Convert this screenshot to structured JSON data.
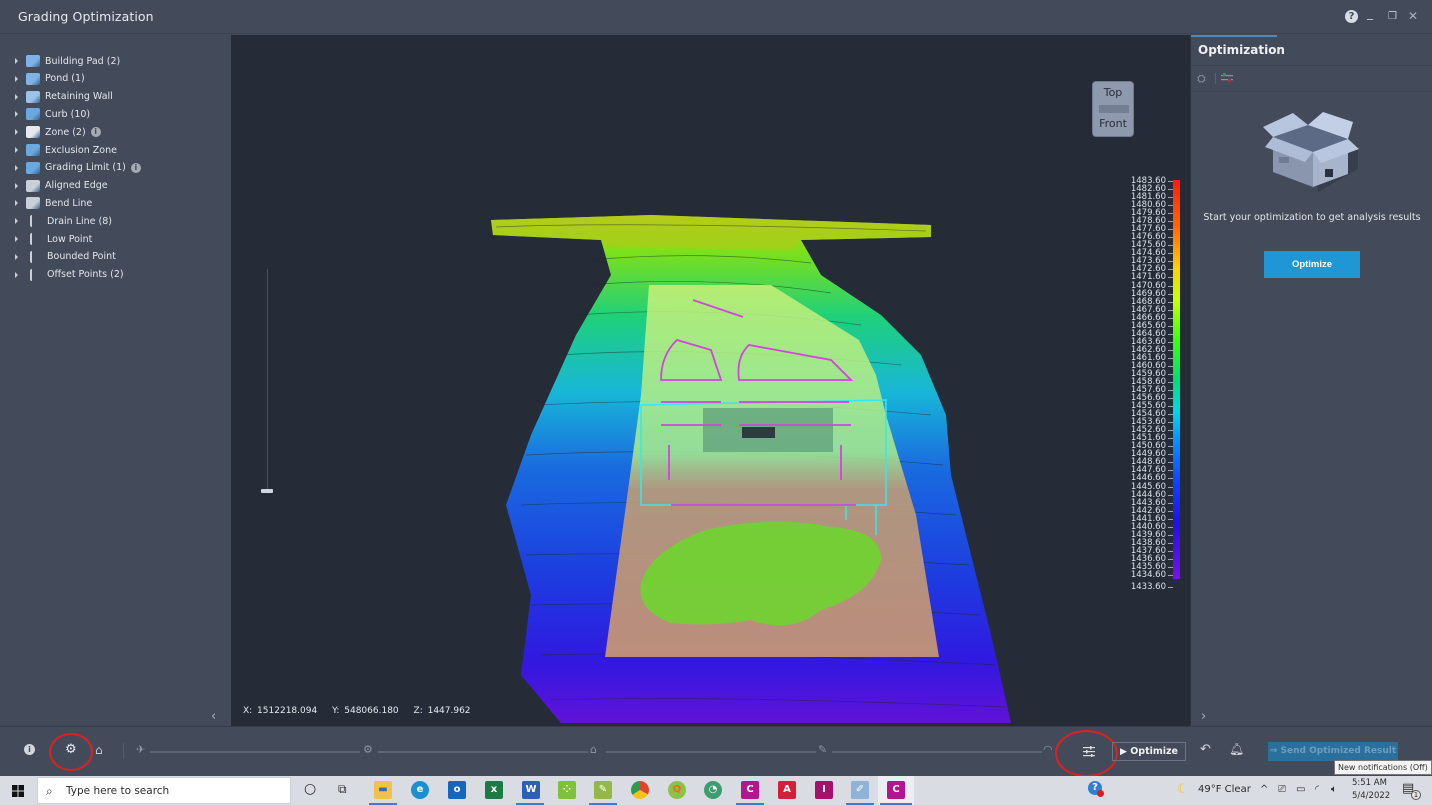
{
  "window": {
    "title": "Grading Optimization",
    "controls": {
      "help": "?",
      "minimize": "_",
      "restore": "❐",
      "close": "✕"
    }
  },
  "sidebar": {
    "items": [
      {
        "label": "Building Pad (2)",
        "icon": "building-pad-icon",
        "info": false
      },
      {
        "label": "Pond (1)",
        "icon": "pond-icon",
        "info": false
      },
      {
        "label": "Retaining Wall",
        "icon": "retaining-wall-icon",
        "info": false
      },
      {
        "label": "Curb (10)",
        "icon": "curb-icon",
        "info": false
      },
      {
        "label": "Zone (2)",
        "icon": "zone-icon",
        "info": true
      },
      {
        "label": "Exclusion Zone",
        "icon": "exclusion-zone-icon",
        "info": false
      },
      {
        "label": "Grading Limit (1)",
        "icon": "grading-limit-icon",
        "info": true
      },
      {
        "label": "Aligned Edge",
        "icon": "aligned-edge-icon",
        "info": false
      },
      {
        "label": "Bend Line",
        "icon": "bend-line-icon",
        "info": false
      },
      {
        "label": "Drain Line (8)",
        "icon": "drain-line-icon",
        "info": false
      },
      {
        "label": "Low Point",
        "icon": "low-point-icon",
        "info": false
      },
      {
        "label": "Bounded Point",
        "icon": "bounded-point-icon",
        "info": false
      },
      {
        "label": "Offset Points (2)",
        "icon": "offset-points-icon",
        "info": false
      }
    ],
    "info_glyph": "i",
    "collapse_glyph": "‹"
  },
  "viewport": {
    "viewcube": {
      "top": "Top",
      "front": "Front"
    },
    "coords": {
      "x": "X: 1512218.094",
      "y": "Y: 548066.180",
      "z": "Z: 1447.962"
    },
    "elevation_legend": {
      "max": 1483.6,
      "min": 1433.6,
      "step": 1.0,
      "labels": [
        "1483.60",
        "1482.60",
        "1481.60",
        "1480.60",
        "1479.60",
        "1478.60",
        "1477.60",
        "1476.60",
        "1475.60",
        "1474.60",
        "1473.60",
        "1472.60",
        "1471.60",
        "1470.60",
        "1469.60",
        "1468.60",
        "1467.60",
        "1466.60",
        "1465.60",
        "1464.60",
        "1463.60",
        "1462.60",
        "1461.60",
        "1460.60",
        "1459.60",
        "1458.60",
        "1457.60",
        "1456.60",
        "1455.60",
        "1454.60",
        "1453.60",
        "1452.60",
        "1451.60",
        "1450.60",
        "1449.60",
        "1448.60",
        "1447.60",
        "1446.60",
        "1445.60",
        "1444.60",
        "1443.60",
        "1442.60",
        "1441.60",
        "1440.60",
        "1439.60",
        "1438.60",
        "1437.60",
        "1436.60",
        "1435.60",
        "1434.60",
        "1433.60"
      ],
      "colors": {
        "high": "#ff1a10",
        "mid_high": "#ffd000",
        "mid": "#3aff10",
        "mid_low": "#00d6e8",
        "low": "#1040ff",
        "lowest": "#7a10e8"
      }
    },
    "vertical_slider_value": 0
  },
  "right_panel": {
    "title": "Optimization",
    "empty_message": "Start your optimization to get analysis results",
    "optimize_label": "Optimize",
    "collapse_glyph": "›"
  },
  "bottom_toolbar": {
    "optimize_label": "Optimize",
    "send_label": "Send Optimized Result",
    "tooltip": "New notifications (Off)",
    "accent": "#1f97d6",
    "highlight_circle_color": "#e02020"
  },
  "taskbar": {
    "search_placeholder": "Type here to search",
    "weather": "49°F  Clear",
    "time": "5:51 AM",
    "date": "5/4/2022",
    "notification_count": "1",
    "apps": [
      {
        "name": "cortana",
        "glyph": "○"
      },
      {
        "name": "task-view",
        "glyph": "⧉"
      },
      {
        "name": "file-explorer",
        "glyph": ""
      },
      {
        "name": "edge",
        "glyph": "e"
      },
      {
        "name": "outlook",
        "glyph": "o"
      },
      {
        "name": "excel",
        "glyph": "x"
      },
      {
        "name": "word",
        "glyph": "W"
      },
      {
        "name": "app-green",
        "glyph": ""
      },
      {
        "name": "app-notepad",
        "glyph": ""
      },
      {
        "name": "chrome",
        "glyph": ""
      },
      {
        "name": "qgis",
        "glyph": "Q"
      },
      {
        "name": "app-globe",
        "glyph": ""
      },
      {
        "name": "civil3d-1",
        "glyph": "C"
      },
      {
        "name": "autocad",
        "glyph": "A"
      },
      {
        "name": "infraworks",
        "glyph": "I"
      },
      {
        "name": "paint",
        "glyph": ""
      },
      {
        "name": "civil3d-2",
        "glyph": "C"
      }
    ]
  }
}
